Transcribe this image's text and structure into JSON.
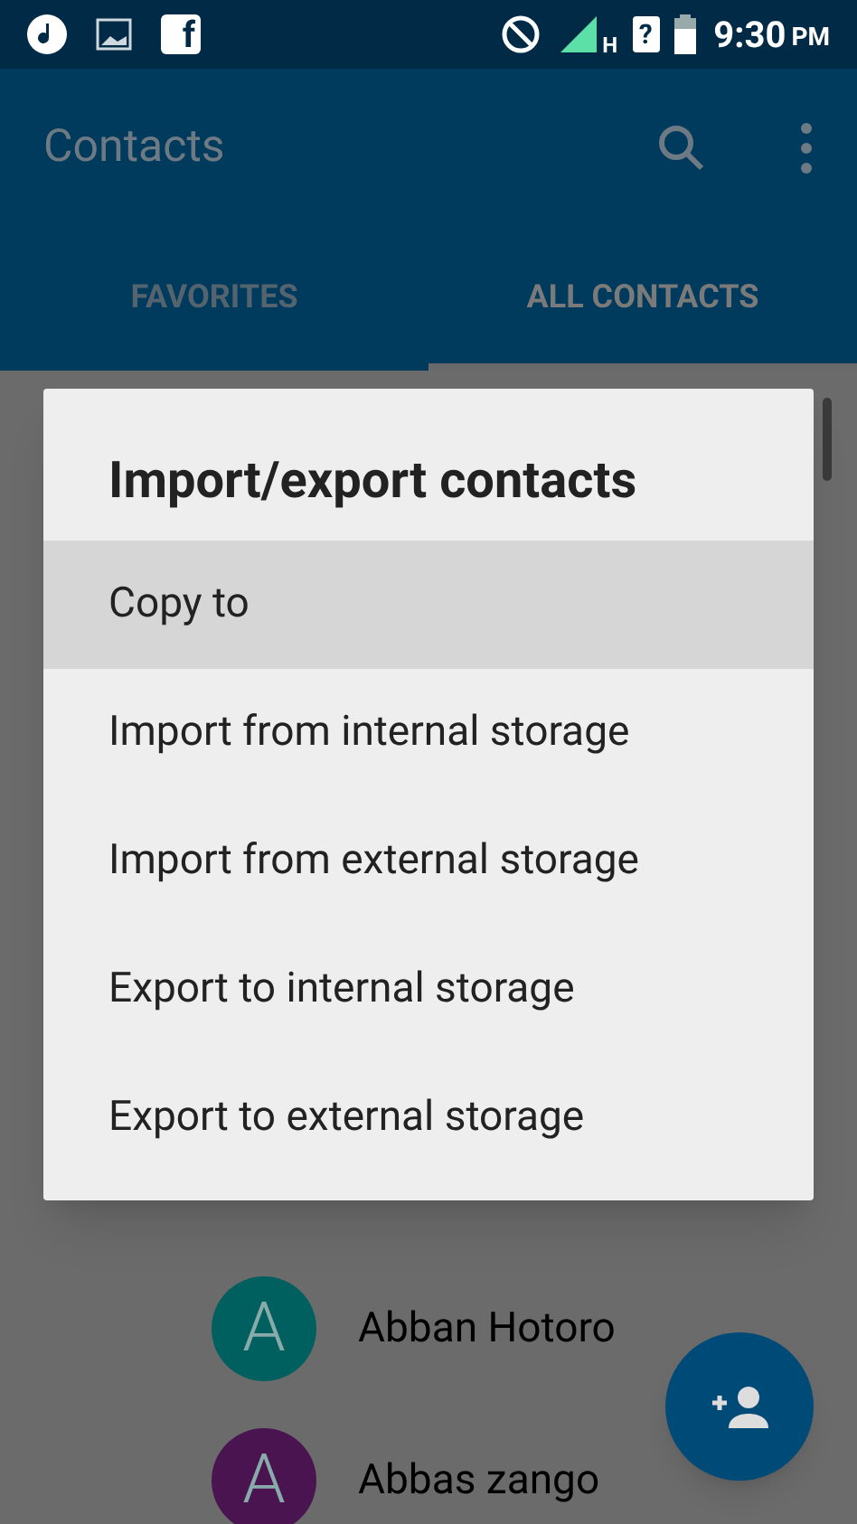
{
  "status_bar": {
    "app_letter": "f",
    "network_type": "H",
    "sim_mark": "?",
    "time": "9:30",
    "period": "PM"
  },
  "app_bar": {
    "title": "Contacts"
  },
  "tabs": [
    {
      "label": "FAVORITES",
      "selected": false
    },
    {
      "label": "ALL CONTACTS",
      "selected": true
    }
  ],
  "dialog": {
    "title": "Import/export contacts",
    "items": [
      {
        "label": "Copy to",
        "selected": true
      },
      {
        "label": "Import from internal storage",
        "selected": false
      },
      {
        "label": "Import from external storage",
        "selected": false
      },
      {
        "label": "Export to internal storage",
        "selected": false
      },
      {
        "label": "Export to external storage",
        "selected": false
      }
    ]
  },
  "contacts": [
    {
      "initial": "A",
      "name": "Abban Hotoro",
      "color": "#00605f"
    },
    {
      "initial": "A",
      "name": "Abbas zango",
      "color": "#4a1450"
    }
  ]
}
